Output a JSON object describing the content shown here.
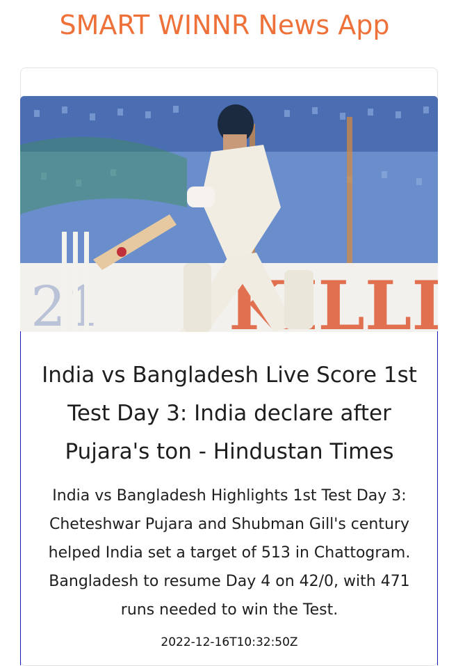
{
  "app": {
    "title": "SMART WINNR News App",
    "accent_color": "#ee7139"
  },
  "article": {
    "image_alt": "Cricket batsman playing a shot near the stumps",
    "headline": "India vs Bangladesh Live Score 1st Test Day 3: India declare after Pujara's ton - Hindustan Times",
    "summary": "India vs Bangladesh Highlights 1st Test Day 3: Cheteshwar Pujara and Shubman Gill's century helped India set a target of 513 in Chattogram. Bangladesh to resume Day 4 on 42/0, with 471 runs needed to win the Test.",
    "published_at": "2022-12-16T10:32:50Z"
  }
}
